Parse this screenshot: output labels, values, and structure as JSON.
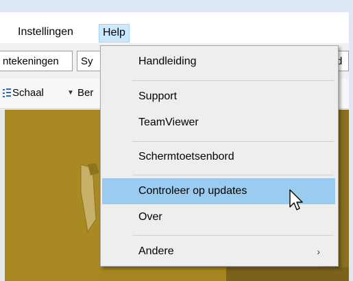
{
  "menubar": {
    "items": [
      {
        "label": "Instellingen"
      },
      {
        "label": "Help"
      }
    ]
  },
  "tabs": [
    {
      "label": "ntekeningen"
    },
    {
      "label": "Sy"
    },
    {
      "label": "d"
    }
  ],
  "toolbar": {
    "schaal_label": "Schaal",
    "next_label": "Ber"
  },
  "help_menu": {
    "items": [
      {
        "label": "Handleiding"
      },
      {
        "label": "Support"
      },
      {
        "label": "TeamViewer"
      },
      {
        "label": "Schermtoetsenbord"
      },
      {
        "label": "Controleer op updates",
        "highlighted": true
      },
      {
        "label": "Over"
      },
      {
        "label": "Andere",
        "submenu": true
      }
    ]
  },
  "colors": {
    "menu_hover": "#cce8ff",
    "item_highlight": "#9ccbf0",
    "map": "#a5861f"
  }
}
